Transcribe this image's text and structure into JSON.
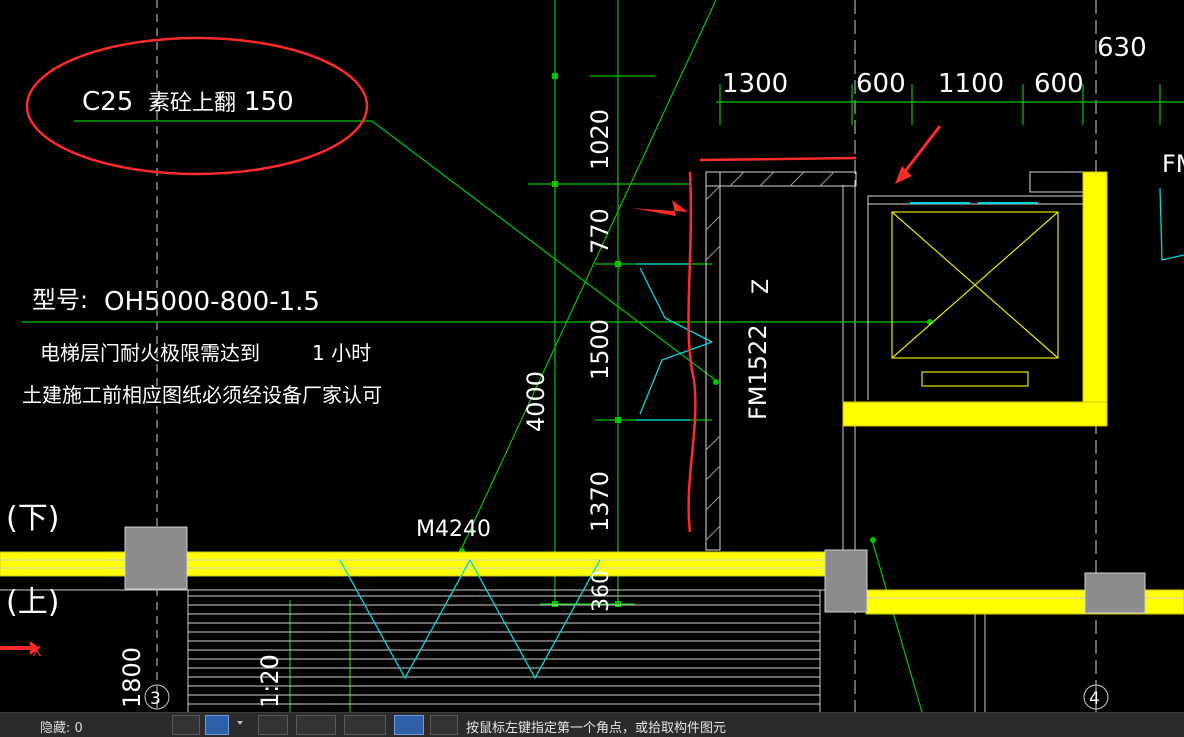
{
  "drawing": {
    "dimensions_top": [
      "1300",
      "600",
      "1100",
      "600",
      "630"
    ],
    "dimensions_vertical": [
      "1020",
      "770",
      "1500",
      "1370",
      "360",
      "4000"
    ],
    "note_concrete": {
      "grade": "C25",
      "desc": "素砼上翻",
      "height": "150"
    },
    "model_label": "型号:",
    "model_value": "OH5000-800-1.5",
    "fire_note_line": "电梯层门耐火极限需达到",
    "fire_note_value": "1 小时",
    "construction_note": "土建施工前相应图纸必须经设备厂家认可",
    "door_fm1522": "FM1522",
    "door_m4240": "M4240",
    "door_fm_cut": "FM",
    "mark_z": "Z",
    "stair_down": "(下)",
    "stair_up": "(上)",
    "axis_x": "X",
    "grid_3": "3",
    "grid_4": "4",
    "dim_1800": "1800",
    "scale_text": "1:20",
    "colors": {
      "wall_fill": "#ffff00",
      "line_green": "#00c800",
      "door_cyan": "#00d8e0",
      "markup_red": "#ff2a2a",
      "column_gray": "#8c8c8c"
    }
  },
  "status_bar": {
    "hidden_label": "隐藏: 0",
    "prompt": "按鼠标左键指定第一个角点，或拾取构件图元",
    "icons": [
      "snap-icon",
      "rect-select-icon",
      "cross-select-icon",
      "line-tool-icon",
      "point-tool-icon",
      "display-icon",
      "polyline-icon"
    ]
  }
}
